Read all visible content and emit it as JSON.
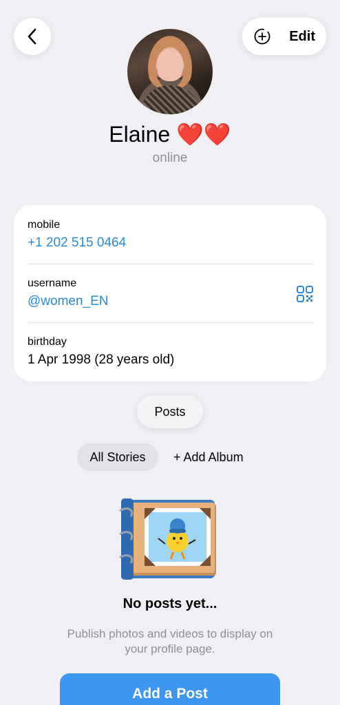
{
  "header": {
    "edit_label": "Edit"
  },
  "profile": {
    "name": "Elaine",
    "name_emoji": "❤️❤️",
    "status": "online"
  },
  "info": {
    "mobile_label": "mobile",
    "mobile_value": "+1 202 515 0464",
    "username_label": "username",
    "username_value": "@women_EN",
    "birthday_label": "birthday",
    "birthday_value": "1 Apr 1998 (28 years old)"
  },
  "sections": {
    "posts_label": "Posts",
    "tab_all_stories": "All Stories",
    "tab_add_album": "+ Add Album"
  },
  "empty_state": {
    "title": "No posts yet...",
    "description": "Publish photos and videos to display on your profile page."
  },
  "actions": {
    "add_post_label": "Add a Post"
  },
  "colors": {
    "accent": "#2a8ad8",
    "button": "#3d96f0",
    "background": "#efeff4"
  },
  "icons": [
    "chevron-left-icon",
    "add-circle-icon",
    "qr-code-icon"
  ]
}
